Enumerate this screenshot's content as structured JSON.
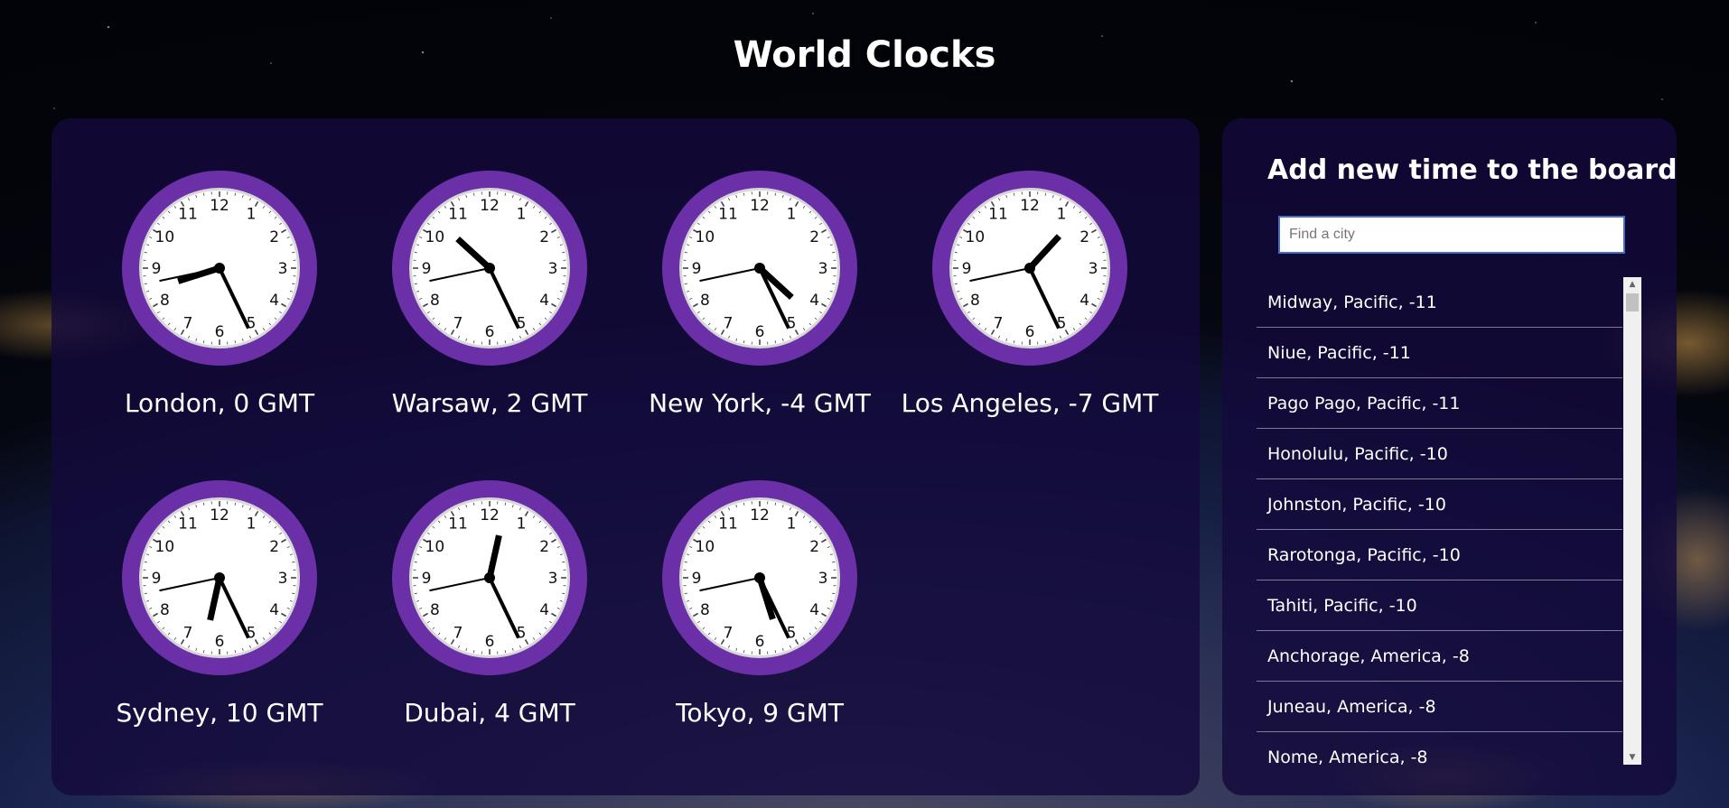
{
  "page": {
    "title": "World Clocks"
  },
  "clocks": [
    {
      "label": "London, 0 GMT",
      "hour": 8,
      "minute": 25,
      "second": 43
    },
    {
      "label": "Warsaw, 2 GMT",
      "hour": 10,
      "minute": 25,
      "second": 43
    },
    {
      "label": "New York, -4 GMT",
      "hour": 4,
      "minute": 25,
      "second": 43
    },
    {
      "label": "Los Angeles, -7 GMT",
      "hour": 1,
      "minute": 25,
      "second": 43
    },
    {
      "label": "Sydney, 10 GMT",
      "hour": 6,
      "minute": 25,
      "second": 43
    },
    {
      "label": "Dubai, 4 GMT",
      "hour": 12,
      "minute": 25,
      "second": 43
    },
    {
      "label": "Tokyo, 9 GMT",
      "hour": 5,
      "minute": 25,
      "second": 43
    }
  ],
  "dial_numbers": [
    "12",
    "1",
    "2",
    "3",
    "4",
    "5",
    "6",
    "7",
    "8",
    "9",
    "10",
    "11"
  ],
  "side_panel": {
    "title": "Add new time to the board",
    "search_placeholder": "Find a city",
    "search_value": "",
    "cities": [
      "Midway, Pacific, -11",
      "Niue, Pacific, -11",
      "Pago Pago, Pacific, -11",
      "Honolulu, Pacific, -10",
      "Johnston, Pacific, -10",
      "Rarotonga, Pacific, -10",
      "Tahiti, Pacific, -10",
      "Anchorage, America, -8",
      "Juneau, America, -8",
      "Nome, America, -8"
    ]
  },
  "colors": {
    "clock_ring": "#6b2fa8",
    "clock_face": "#ffffff",
    "panel_bg": "#140a3c",
    "search_border": "#4b6cc4"
  },
  "icons": {
    "scroll_up": "triangle-up-icon",
    "scroll_down": "triangle-down-icon"
  }
}
